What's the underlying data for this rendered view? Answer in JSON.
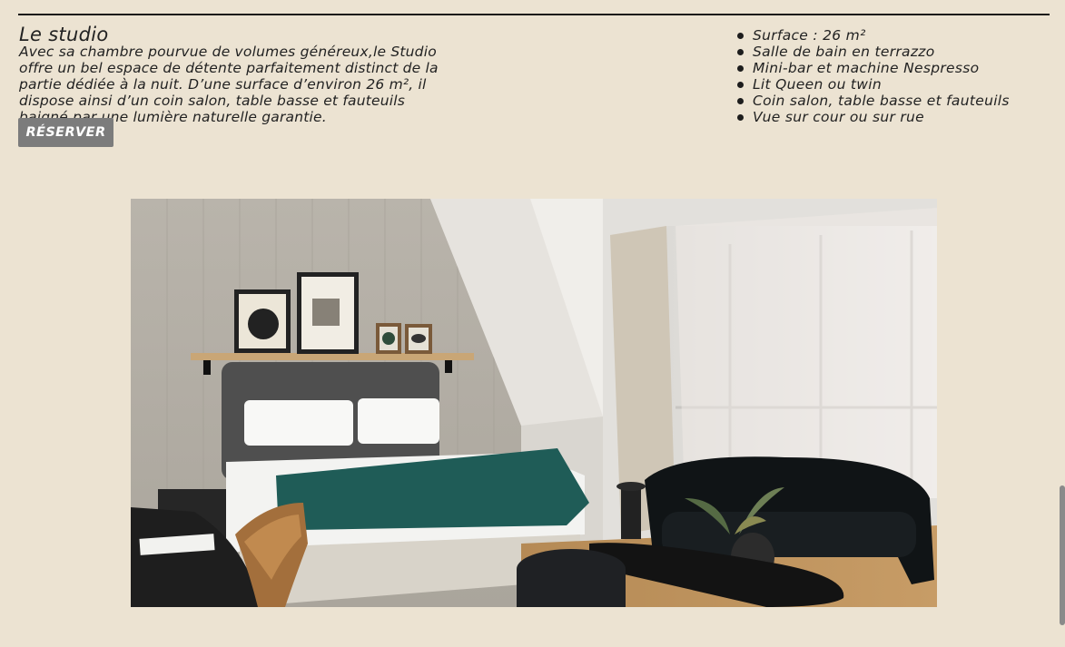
{
  "room": {
    "title": "Le studio",
    "description_lines": [
      "Avec sa chambre pourvue de volumes généreux,le Studio",
      "offre un bel espace de détente parfaitement distinct de la",
      "partie dédiée à la nuit. D’une surface d’environ 26 m², il",
      "dispose ainsi d’un coin salon, table basse et fauteuils",
      "baigné par une lumière naturelle garantie."
    ],
    "reserve_label": "RÉSERVER"
  },
  "features": [
    "Surface : 26 m²",
    "Salle de bain en terrazzo",
    "Mini-bar et machine Nespresso",
    "Lit Queen ou twin",
    "Coin salon, table basse et fauteuils",
    "Vue sur cour ou sur rue"
  ],
  "colors": {
    "background": "#ece3d2",
    "button": "#7c7c7c",
    "throw": "#1f5c57"
  }
}
